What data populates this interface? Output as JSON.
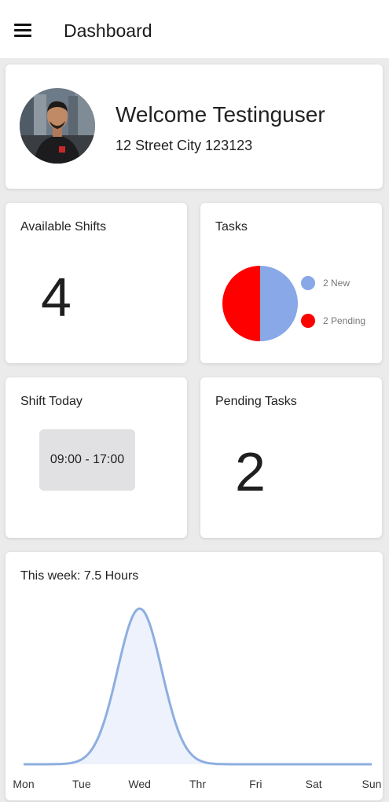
{
  "appbar": {
    "title": "Dashboard",
    "menu_icon": "hamburger-menu-icon"
  },
  "welcome": {
    "title": "Welcome Testinguser",
    "address": "12 Street City 123123"
  },
  "available_shifts": {
    "label": "Available Shifts",
    "value": "4"
  },
  "tasks": {
    "label": "Tasks",
    "legend_new": "2 New",
    "legend_pending": "2 Pending",
    "colors": {
      "new": "#88a8e8",
      "pending": "#ff0000"
    }
  },
  "shift_today": {
    "label": "Shift Today",
    "time": "09:00 - 17:00"
  },
  "pending_tasks": {
    "label": "Pending Tasks",
    "value": "2"
  },
  "week": {
    "label": "This week: 7.5 Hours",
    "color": "#8eaee0"
  },
  "chart_data": [
    {
      "type": "pie",
      "title": "",
      "labels": [
        "2 New",
        "2 Pending"
      ],
      "values": [
        2,
        2
      ],
      "colors": [
        "#88a8e8",
        "#ff0000"
      ],
      "legend": "right"
    },
    {
      "type": "area",
      "title": "This week: 7.5 Hours",
      "categories": [
        "Mon",
        "Tue",
        "Wed",
        "Thr",
        "Fri",
        "Sat",
        "Sun"
      ],
      "values": [
        0,
        0,
        7.5,
        0,
        0,
        0,
        0
      ],
      "smooth": true,
      "grid": false
    }
  ]
}
